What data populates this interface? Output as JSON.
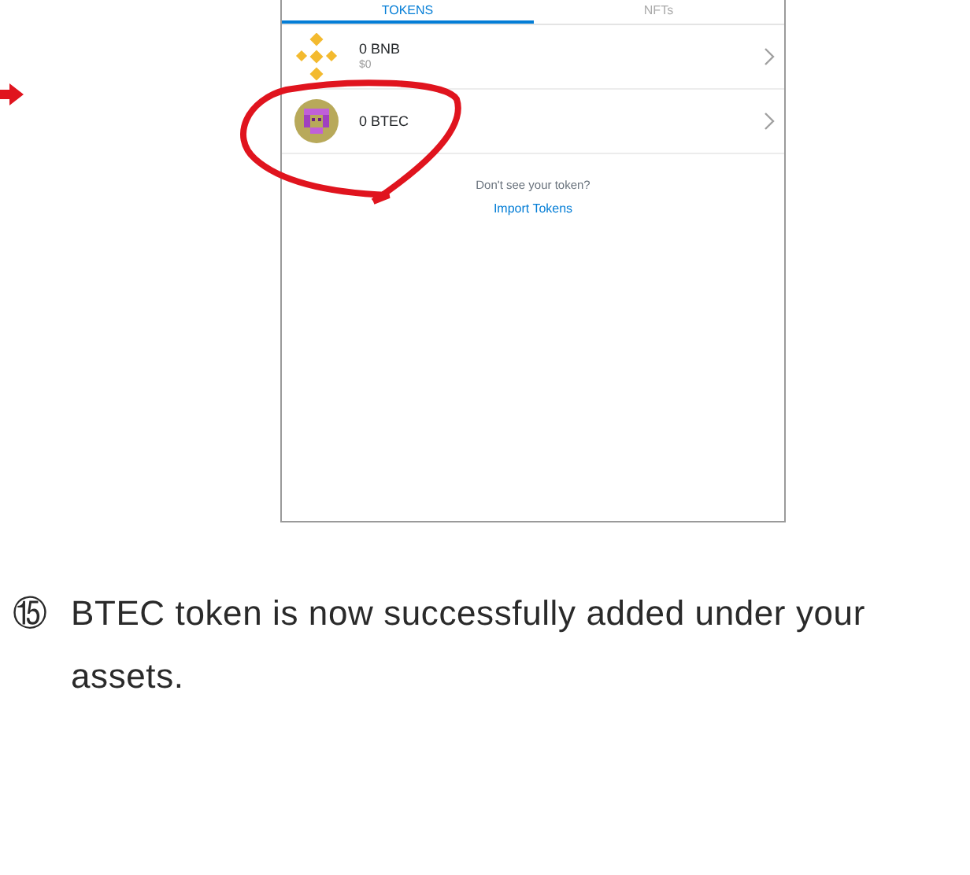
{
  "tabs": [
    {
      "label": "TOKENS",
      "selected": true
    },
    {
      "label": "NFTs",
      "selected": false
    }
  ],
  "tokens": [
    {
      "kind": "bnb",
      "amount": "0 BNB",
      "fiat": "$0"
    },
    {
      "kind": "btec",
      "amount": "0 BTEC"
    }
  ],
  "import_prompt": "Don't see your token?",
  "import_link": "Import Tokens",
  "caption": {
    "marker": "⑮",
    "text": "BTEC token is now successfully added under your assets."
  }
}
